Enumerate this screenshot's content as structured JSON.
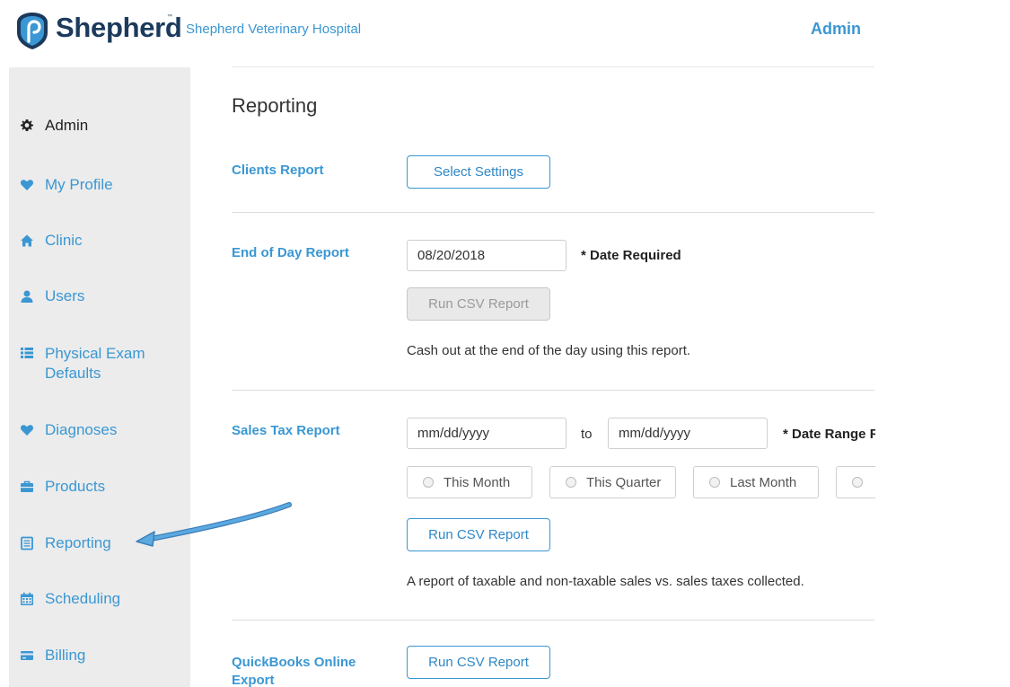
{
  "header": {
    "brand": "Shepherd",
    "brand_tm": "™",
    "clinic_name": "Shepherd Veterinary Hospital",
    "admin_link": "Admin"
  },
  "sidebar": {
    "items": [
      {
        "label": "Admin",
        "icon": "gear-icon",
        "active": true
      },
      {
        "label": "My Profile",
        "icon": "heart-icon"
      },
      {
        "label": "Clinic",
        "icon": "home-icon"
      },
      {
        "label": "Users",
        "icon": "user-icon"
      },
      {
        "label": "Physical Exam",
        "label2": "Defaults",
        "icon": "list-icon"
      },
      {
        "label": "Diagnoses",
        "icon": "heart-icon"
      },
      {
        "label": "Products",
        "icon": "briefcase-icon"
      },
      {
        "label": "Reporting",
        "icon": "report-icon"
      },
      {
        "label": "Scheduling",
        "icon": "calendar-icon"
      },
      {
        "label": "Billing",
        "icon": "credit-card-icon"
      }
    ]
  },
  "main": {
    "title": "Reporting",
    "clients_report": {
      "label": "Clients Report",
      "button": "Select Settings"
    },
    "end_of_day": {
      "label": "End of Day Report",
      "date_value": "08/20/2018",
      "required_note": "* Date Required",
      "button": "Run CSV Report",
      "description": "Cash out at the end of the day using this report."
    },
    "sales_tax": {
      "label": "Sales Tax Report",
      "from_placeholder": "mm/dd/yyyy",
      "to_label": "to",
      "to_placeholder": "mm/dd/yyyy",
      "required_note": "* Date Range R",
      "presets": [
        "This Month",
        "This Quarter",
        "Last Month",
        ""
      ],
      "button": "Run CSV Report",
      "description": "A report of taxable and non-taxable sales vs. sales taxes collected."
    },
    "quickbooks": {
      "label_line1": "QuickBooks Online",
      "label_line2": "Export",
      "button": "Run CSV Report"
    }
  },
  "colors": {
    "accent": "#3a97d3",
    "brand": "#1b3a5c",
    "sidebar_bg": "#ececec",
    "annotation_arrow": "#4a9fd6"
  }
}
